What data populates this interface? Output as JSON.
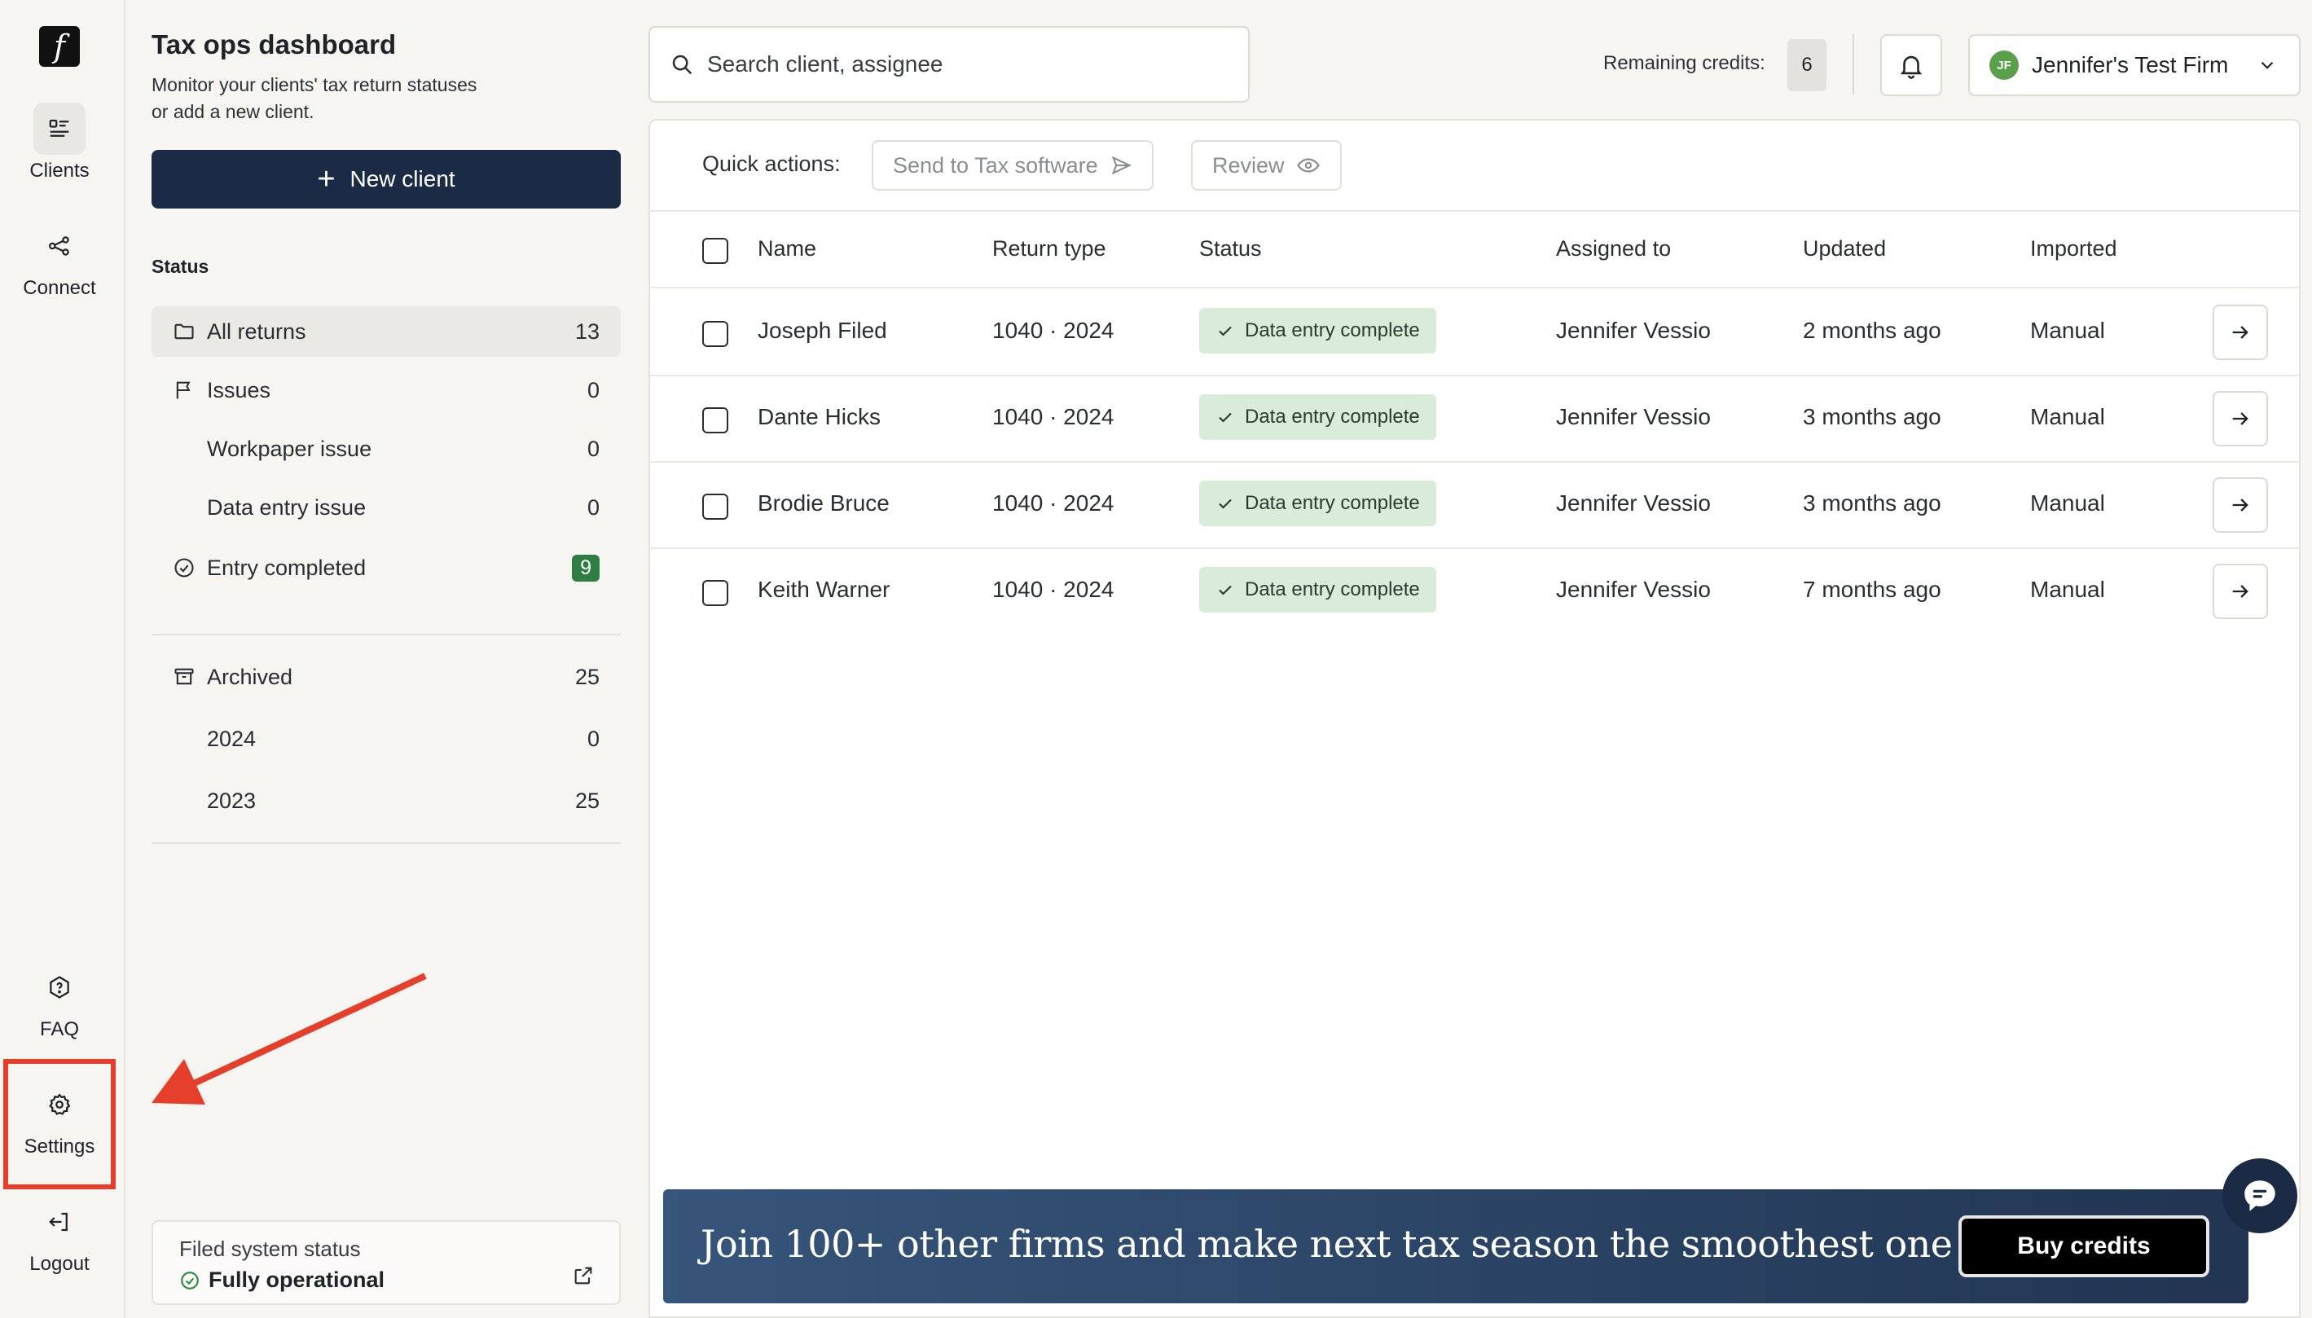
{
  "rail": {
    "logo": "f",
    "items": [
      {
        "label": "Clients",
        "icon": "clients-icon"
      },
      {
        "label": "Connect",
        "icon": "connect-icon"
      },
      {
        "label": "FAQ",
        "icon": "faq-icon"
      },
      {
        "label": "Settings",
        "icon": "gear-icon"
      },
      {
        "label": "Logout",
        "icon": "logout-icon"
      }
    ]
  },
  "panel": {
    "title": "Tax ops dashboard",
    "subtitle": "Monitor your clients' tax return statuses or add a new client.",
    "new_client_label": "New client",
    "status_heading": "Status",
    "status_items": [
      {
        "label": "All returns",
        "count": "13"
      },
      {
        "label": "Issues",
        "count": "0"
      },
      {
        "label": "Workpaper issue",
        "count": "0"
      },
      {
        "label": "Data entry issue",
        "count": "0"
      },
      {
        "label": "Entry completed",
        "count": "9"
      }
    ],
    "archived": [
      {
        "label": "Archived",
        "count": "25"
      },
      {
        "label": "2024",
        "count": "0"
      },
      {
        "label": "2023",
        "count": "25"
      }
    ],
    "system_status": {
      "title": "Filed system status",
      "value": "Fully operational"
    }
  },
  "topbar": {
    "search_placeholder": "Search client, assignee",
    "credits_label": "Remaining credits:",
    "credits_value": "6",
    "firm_initials": "JF",
    "firm_name": "Jennifer's Test Firm"
  },
  "quick_actions": {
    "label": "Quick actions:",
    "send_label": "Send to Tax software",
    "review_label": "Review"
  },
  "table": {
    "columns": [
      "Name",
      "Return type",
      "Status",
      "Assigned to",
      "Updated",
      "Imported"
    ],
    "rows": [
      {
        "name": "Joseph Filed",
        "return_type": "1040 · 2024",
        "status": "Data entry complete",
        "assigned": "Jennifer Vessio",
        "updated": "2 months ago",
        "imported": "Manual"
      },
      {
        "name": "Dante Hicks",
        "return_type": "1040 · 2024",
        "status": "Data entry complete",
        "assigned": "Jennifer Vessio",
        "updated": "3 months ago",
        "imported": "Manual"
      },
      {
        "name": "Brodie Bruce",
        "return_type": "1040 · 2024",
        "status": "Data entry complete",
        "assigned": "Jennifer Vessio",
        "updated": "3 months ago",
        "imported": "Manual"
      },
      {
        "name": "Keith Warner",
        "return_type": "1040 · 2024",
        "status": "Data entry complete",
        "assigned": "Jennifer Vessio",
        "updated": "7 months ago",
        "imported": "Manual"
      }
    ]
  },
  "banner": {
    "text": "Join 100+ other firms and make next tax season the smoothest one yet.",
    "button_label": "Buy credits"
  },
  "colors": {
    "primary": "#1b2b45",
    "success_badge_bg": "#d9ecd9",
    "count_badge": "#2e7d42",
    "annotation": "#e53e2a"
  }
}
